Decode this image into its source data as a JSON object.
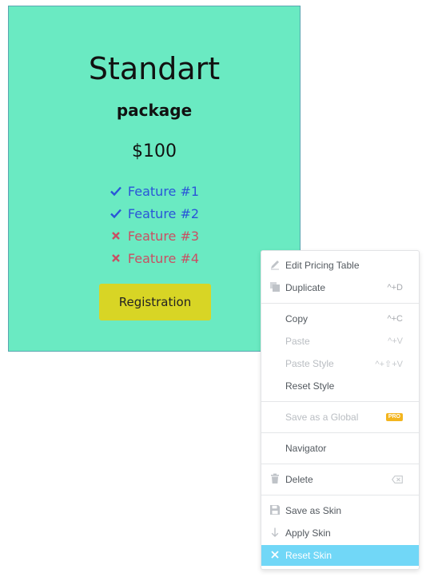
{
  "card": {
    "title": "Standart",
    "subtitle": "package",
    "price": "$100",
    "features": [
      {
        "label": "Feature #1",
        "included": true
      },
      {
        "label": "Feature #2",
        "included": true
      },
      {
        "label": "Feature #3",
        "included": false
      },
      {
        "label": "Feature #4",
        "included": false
      }
    ],
    "button_label": "Registration",
    "background_color": "#6aeac2",
    "button_color": "#d8d525"
  },
  "context_menu": {
    "edit": {
      "label": "Edit Pricing Table",
      "icon": "pencil-icon"
    },
    "duplicate": {
      "label": "Duplicate",
      "shortcut": "^+D",
      "icon": "duplicate-icon"
    },
    "copy": {
      "label": "Copy",
      "shortcut": "^+C"
    },
    "paste": {
      "label": "Paste",
      "shortcut": "^+V",
      "disabled": true
    },
    "paste_style": {
      "label": "Paste Style",
      "shortcut": "^+⇧+V",
      "disabled": true
    },
    "reset_style": {
      "label": "Reset Style"
    },
    "save_global": {
      "label": "Save as a Global",
      "badge": "PRO",
      "disabled": true
    },
    "navigator": {
      "label": "Navigator"
    },
    "delete": {
      "label": "Delete",
      "icon": "trash-icon",
      "shortcut_icon": "backspace-icon"
    },
    "save_skin": {
      "label": "Save as Skin",
      "icon": "save-icon"
    },
    "apply_skin": {
      "label": "Apply Skin",
      "icon": "arrow-down-icon"
    },
    "reset_skin": {
      "label": "Reset Skin",
      "icon": "close-icon",
      "active": true
    },
    "highlight_color": "#71d7f7"
  }
}
